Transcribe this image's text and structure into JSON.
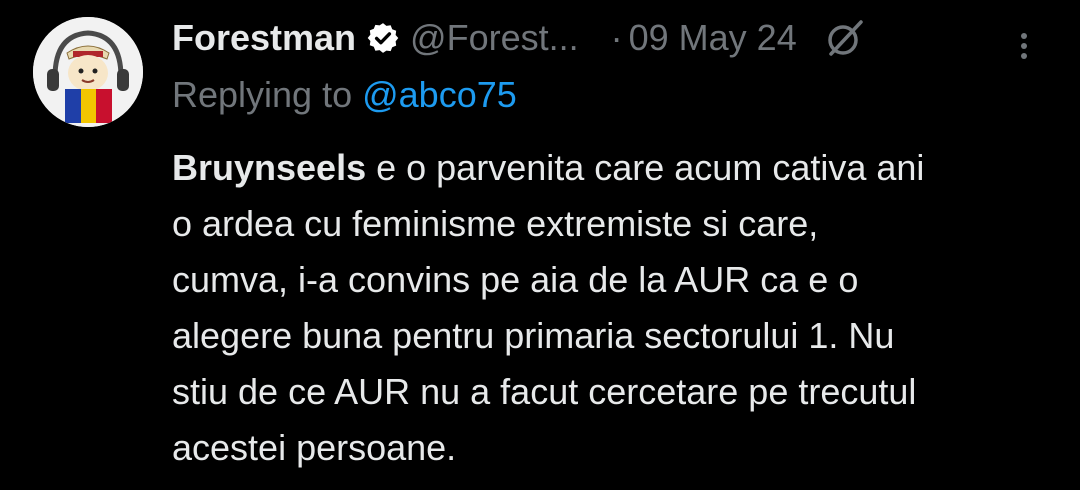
{
  "post": {
    "author_name": "Forestman",
    "author_handle": "@Forest...",
    "separator": "·",
    "date": "09 May 24",
    "verified_icon": "verified-badge-icon",
    "replying_prefix": "Replying to ",
    "replying_to": "@abco75",
    "body_bold": "Bruynseels",
    "body_lines": [
      " e o parvenita care acum cativa ani",
      "o ardea cu feminisme extremiste si care,",
      "cumva, i-a convins pe aia de la AUR ca e o",
      "alegere buna pentru primaria sectorului 1.  Nu",
      "stiu de ce AUR nu a facut cercetare pe trecutul",
      "acestei persoane."
    ]
  },
  "colors": {
    "background": "#000000",
    "primary_text": "#e7e9ea",
    "secondary_text": "#71767b",
    "accent": "#1d9bf0"
  }
}
